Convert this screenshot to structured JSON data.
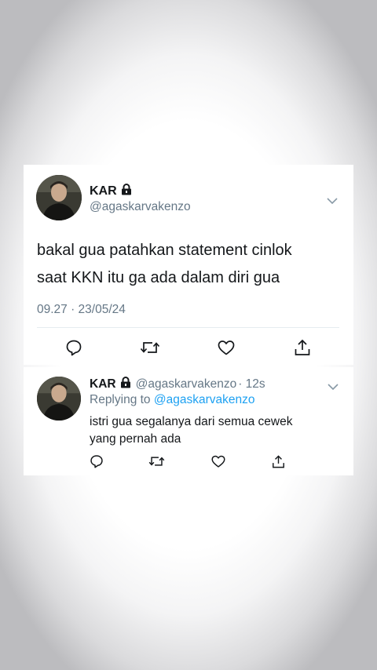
{
  "main_tweet": {
    "author_name": "KAR",
    "author_handle": "@agaskarvakenzo",
    "text_line1": "bakal gua patahkan statement cinlok",
    "text_line2": "saat KKN itu ga ada dalam diri gua",
    "timestamp": "09.27 · 23/05/24",
    "icons": [
      "reply-icon",
      "retweet-icon",
      "like-icon",
      "share-icon"
    ]
  },
  "reply_tweet": {
    "author_name": "KAR",
    "author_handle": "@agaskarvakenzo",
    "time_ago": "· 12s",
    "replying_to_label": "Replying to",
    "replying_to_handle": "@agaskarvakenzo",
    "text_line1": "istri gua segalanya dari semua cewek",
    "text_line2": "yang pernah ada",
    "icons": [
      "reply-icon",
      "retweet-icon",
      "like-icon",
      "share-icon"
    ]
  },
  "colors": {
    "text": "#14171a",
    "secondary": "#657786",
    "link": "#1da1f2",
    "divider": "#e6ecf0"
  }
}
